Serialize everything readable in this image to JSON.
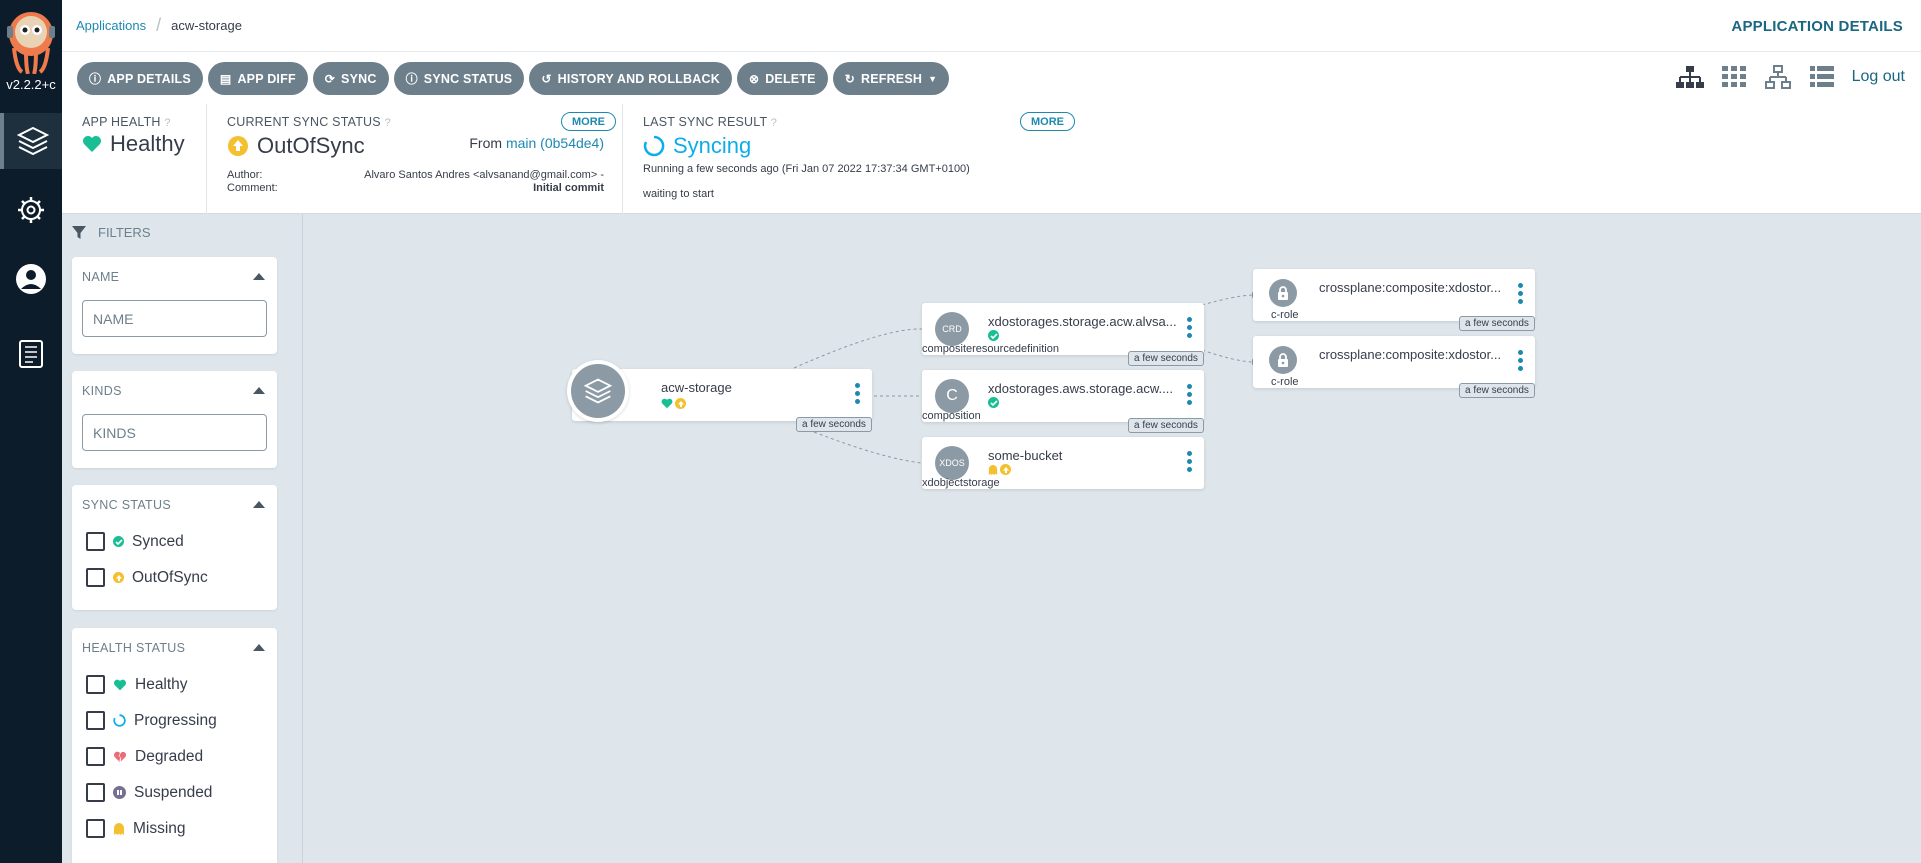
{
  "nav": {
    "version": "v2.2.2+c",
    "items": [
      "applications",
      "settings",
      "user-info",
      "documentation"
    ]
  },
  "breadcrumb": {
    "root": "Applications",
    "current": "acw-storage"
  },
  "page_title": "APPLICATION DETAILS",
  "toolbar": {
    "buttons": [
      {
        "label": "APP DETAILS",
        "icon": "info-icon"
      },
      {
        "label": "APP DIFF",
        "icon": "file-icon"
      },
      {
        "label": "SYNC",
        "icon": "sync-icon"
      },
      {
        "label": "SYNC STATUS",
        "icon": "info-icon"
      },
      {
        "label": "HISTORY AND ROLLBACK",
        "icon": "history-icon"
      },
      {
        "label": "DELETE",
        "icon": "times-circle-icon"
      },
      {
        "label": "REFRESH",
        "icon": "redo-icon"
      }
    ],
    "logout": "Log out"
  },
  "status": {
    "app_health": {
      "label": "APP HEALTH",
      "value": "Healthy"
    },
    "current_sync": {
      "label": "CURRENT SYNC STATUS",
      "value": "OutOfSync",
      "more": "MORE",
      "from_prefix": "From",
      "from_ref": "main (0b54de4)",
      "author_label": "Author:",
      "author_value": "Alvaro Santos Andres <alvsanand@gmail.com> -",
      "comment_label": "Comment:",
      "comment_value": "Initial commit"
    },
    "last_sync": {
      "label": "LAST SYNC RESULT",
      "value": "Syncing",
      "more": "MORE",
      "running": "Running a few seconds ago (Fri Jan 07 2022 17:37:34 GMT+0100)",
      "message": "waiting to start"
    }
  },
  "filters": {
    "title": "FILTERS",
    "name": {
      "title": "NAME",
      "placeholder": "NAME"
    },
    "kinds": {
      "title": "KINDS",
      "placeholder": "KINDS"
    },
    "sync_status": {
      "title": "SYNC STATUS",
      "options": [
        "Synced",
        "OutOfSync"
      ]
    },
    "health_status": {
      "title": "HEALTH STATUS",
      "options": [
        "Healthy",
        "Progressing",
        "Degraded",
        "Suspended",
        "Missing"
      ]
    }
  },
  "graph": {
    "root": {
      "name": "acw-storage",
      "age": "a few seconds"
    },
    "nodes": [
      {
        "badge": "CRD",
        "name": "xdostorages.storage.acw.alvsa...",
        "kind": "compositeresourcedefinition",
        "age": "a few seconds"
      },
      {
        "badge": "C",
        "name": "xdostorages.aws.storage.acw....",
        "kind": "composition",
        "age": "a few seconds"
      },
      {
        "badge": "XDOS",
        "name": "some-bucket",
        "kind": "xdobjectstorage",
        "age": ""
      },
      {
        "badge": "",
        "name": "crossplane:composite:xdostor...",
        "kind": "c-role",
        "age": "a few seconds"
      },
      {
        "badge": "",
        "name": "crossplane:composite:xdostor...",
        "kind": "c-role",
        "age": "a few seconds"
      }
    ]
  },
  "colors": {
    "healthy": "#18be94",
    "outofsync": "#f4c030",
    "syncing": "#0dadea",
    "button": "#6d7f8b",
    "link": "#1e89b0",
    "nav_bg": "#0d1c2a"
  }
}
